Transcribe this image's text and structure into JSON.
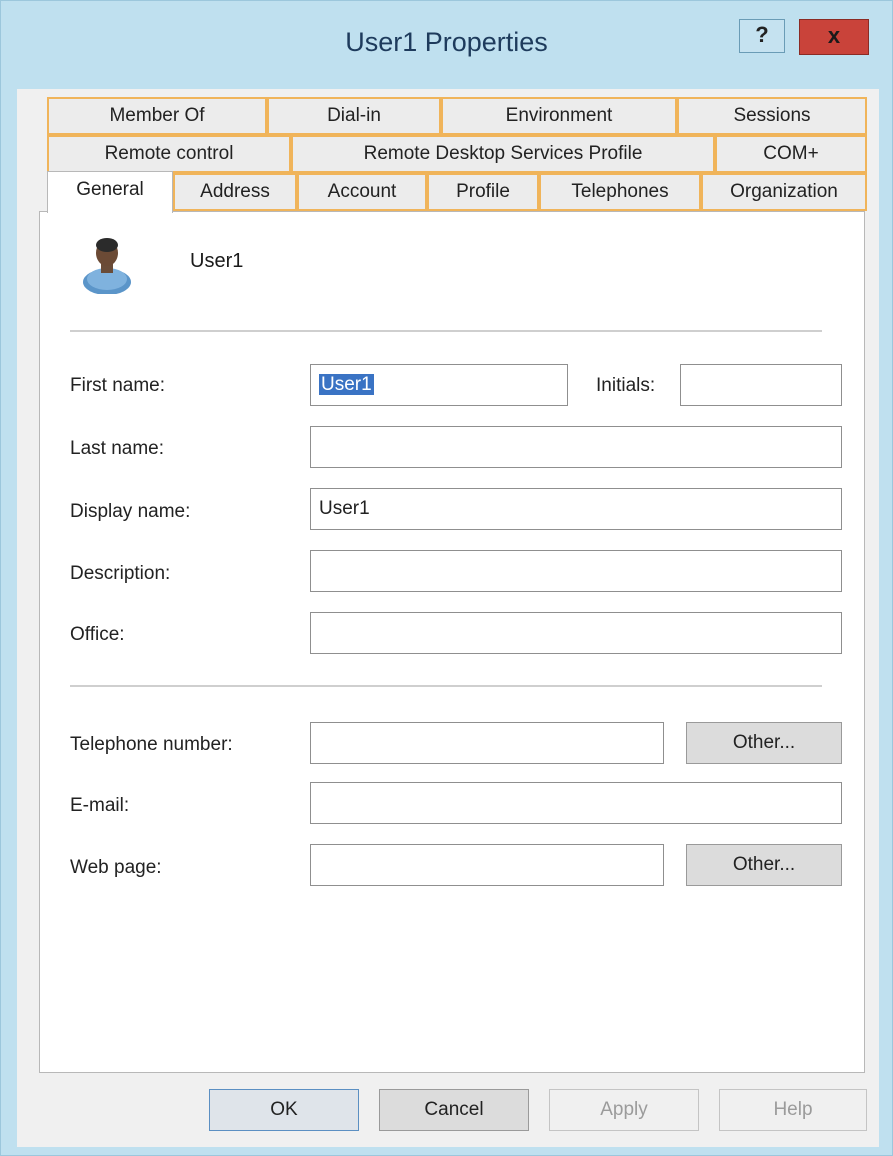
{
  "window": {
    "title": "User1 Properties",
    "help_symbol": "?",
    "close_symbol": "x"
  },
  "tabs": {
    "row1": [
      "Member Of",
      "Dial-in",
      "Environment",
      "Sessions"
    ],
    "row2": [
      "Remote control",
      "Remote Desktop Services Profile",
      "COM+"
    ],
    "row3": [
      "General",
      "Address",
      "Account",
      "Profile",
      "Telephones",
      "Organization"
    ],
    "active": "General"
  },
  "general": {
    "icon": "user-icon",
    "user_name": "User1",
    "fields": {
      "first_name": {
        "label": "First name:",
        "value": "User1"
      },
      "initials": {
        "label": "Initials:",
        "value": ""
      },
      "last_name": {
        "label": "Last name:",
        "value": ""
      },
      "display_name": {
        "label": "Display name:",
        "value": "User1"
      },
      "description": {
        "label": "Description:",
        "value": ""
      },
      "office": {
        "label": "Office:",
        "value": ""
      },
      "telephone": {
        "label": "Telephone number:",
        "value": ""
      },
      "email": {
        "label": "E-mail:",
        "value": ""
      },
      "web_page": {
        "label": "Web page:",
        "value": ""
      }
    },
    "other_label": "Other..."
  },
  "buttons": {
    "ok": "OK",
    "cancel": "Cancel",
    "apply": "Apply",
    "help": "Help"
  }
}
